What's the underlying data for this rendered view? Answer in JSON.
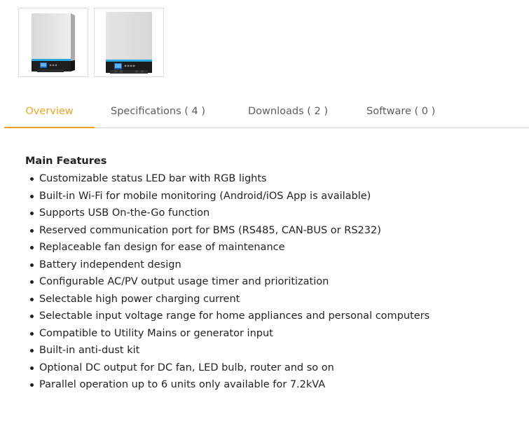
{
  "gallery": {
    "thumbnails": [
      {
        "alt": "inverter-angled-view"
      },
      {
        "alt": "inverter-front-view"
      }
    ]
  },
  "tabs": [
    {
      "label": "Overview",
      "active": true
    },
    {
      "label": "Specifications ( 4 )",
      "active": false
    },
    {
      "label": "Downloads ( 2 )",
      "active": false
    },
    {
      "label": "Software ( 0 )",
      "active": false
    }
  ],
  "overview": {
    "title": "Main Features",
    "features": [
      "Customizable status LED bar with RGB lights",
      "Built-in Wi-Fi for mobile monitoring (Android/iOS App is available)",
      "Supports USB On-the-Go function",
      "Reserved communication port for BMS (RS485, CAN-BUS or RS232)",
      "Replaceable fan design for ease of maintenance",
      "Battery independent design",
      "Configurable AC/PV output usage timer and prioritization",
      "Selectable high power charging current",
      "Selectable input voltage range for home appliances and personal computers",
      "Compatible to Utility Mains or generator input",
      "Built-in anti-dust kit",
      "Optional DC output for DC fan, LED bulb, router and so on",
      "Parallel operation up to 6 units only available for 7.2kVA"
    ]
  },
  "colors": {
    "accent": "#f0a220",
    "tab_text": "#5d5d5d",
    "body_text": "#222222",
    "led_bar": "#2ea8e0"
  }
}
